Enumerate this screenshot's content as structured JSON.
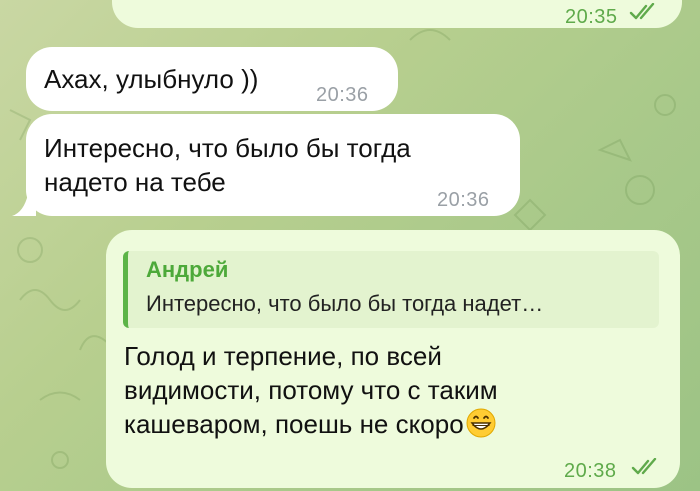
{
  "chat": {
    "messages": [
      {
        "direction": "outgoing",
        "text": "",
        "time": "20:35",
        "read": true
      },
      {
        "direction": "incoming",
        "text": "Ахах, улыбнуло ))",
        "time": "20:36"
      },
      {
        "direction": "incoming",
        "text": "Интересно, что было бы тогда\nнадето на тебе",
        "time": "20:36"
      },
      {
        "direction": "outgoing",
        "reply": {
          "name": "Андрей",
          "text": "Интересно, что было бы тогда надет…"
        },
        "text": "Голод и терпение, по всей\nвидимости, потому что с таким\nкашеваром, поешь не скоро",
        "emoji": "grinning-face",
        "time": "20:38",
        "read": true
      }
    ]
  },
  "colors": {
    "incoming_bubble": "#ffffff",
    "outgoing_bubble": "#eefbdc",
    "accent_green": "#5cb447",
    "time_outgoing": "#5faa4b",
    "time_incoming": "#9aa0a6"
  }
}
